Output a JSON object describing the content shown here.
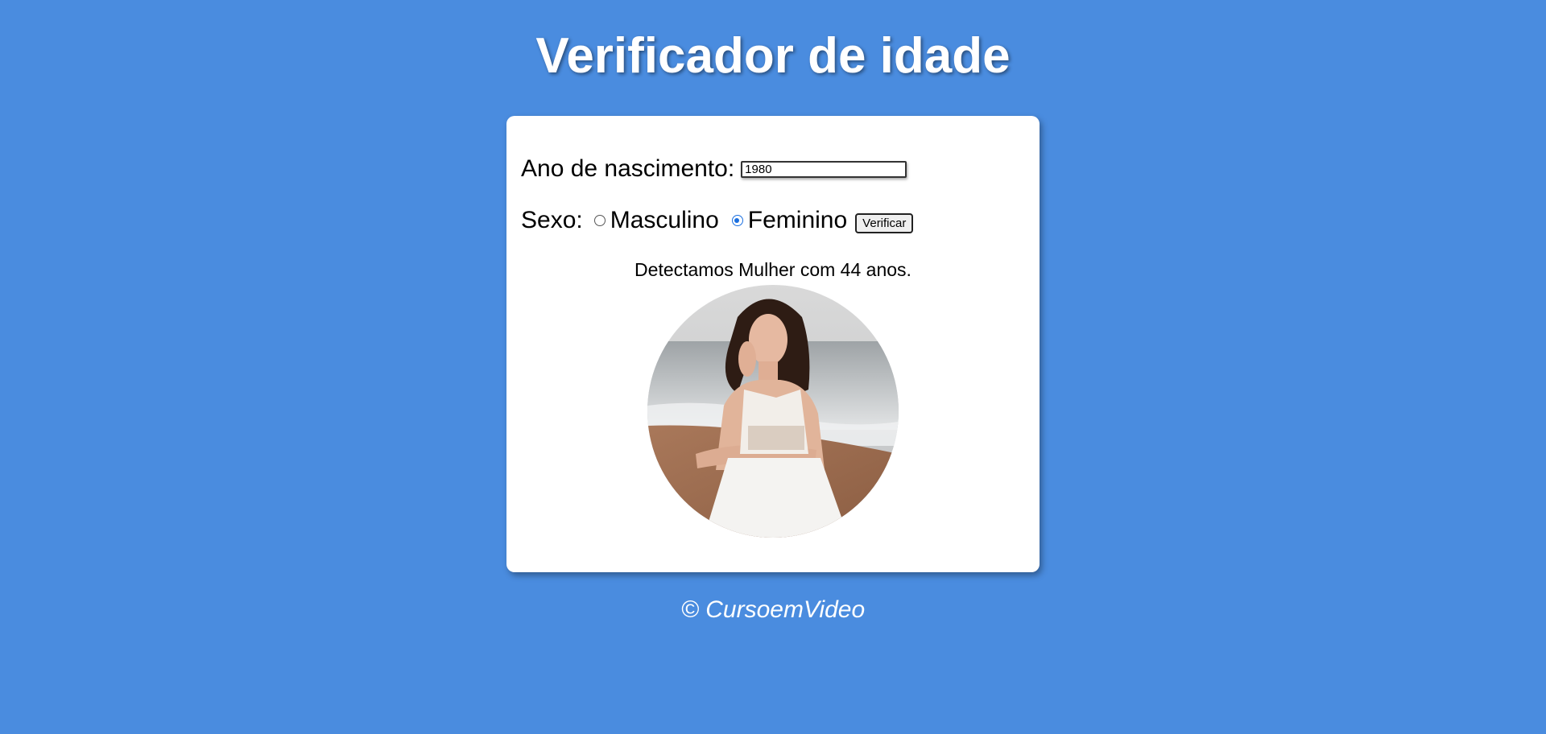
{
  "page": {
    "title": "Verificador de idade",
    "background_color": "#4a8cdf"
  },
  "form": {
    "year_label": "Ano de nascimento:",
    "year_value": "1980",
    "sex_label": "Sexo:",
    "options": [
      {
        "label": "Masculino",
        "checked": false
      },
      {
        "label": "Feminino",
        "checked": true
      }
    ],
    "verify_button": "Verificar"
  },
  "result": {
    "message": "Detectamos Mulher com 44 anos.",
    "photo_icon": "woman-photo"
  },
  "footer": {
    "text": "© CursoemVideo"
  }
}
